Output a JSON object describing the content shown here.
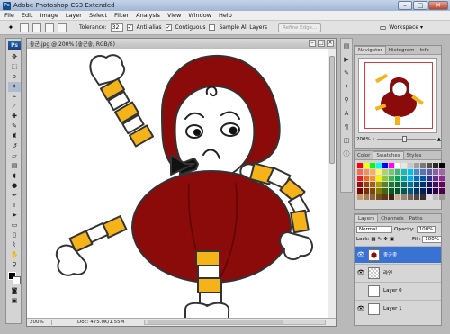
{
  "app": {
    "title": "Adobe Photoshop CS3 Extended",
    "logo_text": "Ps"
  },
  "window_controls": {
    "minimize": "–",
    "maximize": "□",
    "close": "✕"
  },
  "menu": [
    "File",
    "Edit",
    "Image",
    "Layer",
    "Select",
    "Filter",
    "Analysis",
    "View",
    "Window",
    "Help"
  ],
  "options_bar": {
    "tolerance_label": "Tolerance:",
    "tolerance_value": "32",
    "anti_alias_label": "Anti-alias",
    "contiguous_label": "Contiguous",
    "sample_all_label": "Sample All Layers",
    "refine_edge_label": "Refine Edge...",
    "workspace_label": "Workspace ▾"
  },
  "document": {
    "title": "좋군.jpg @ 200% (좋군좋, RGB/8)",
    "zoom": "200%",
    "doc_size": "Doc: 475.0K/1.55M"
  },
  "navigator": {
    "tabs": [
      "Navigator",
      "Histogram",
      "Info"
    ],
    "zoom": "200%"
  },
  "swatches": {
    "tabs": [
      "Color",
      "Swatches",
      "Styles"
    ],
    "colors": [
      "#ff0000",
      "#ffff00",
      "#00ff00",
      "#00ffff",
      "#0000ff",
      "#ff00ff",
      "#ffffff",
      "#e6e6e6",
      "#c8c8c8",
      "#a0a0a0",
      "#787878",
      "#505050",
      "#282828",
      "#000000",
      "#f26c4f",
      "#f68e55",
      "#fbaf5c",
      "#fff467",
      "#acd372",
      "#7cc576",
      "#3bb878",
      "#1abbb4",
      "#00bff3",
      "#438ccb",
      "#5574b9",
      "#605ca8",
      "#855fa8",
      "#a763a8",
      "#ed1c24",
      "#f26522",
      "#f7941d",
      "#fff200",
      "#8dc63f",
      "#39b54a",
      "#00a651",
      "#00a99d",
      "#00aeef",
      "#0072bc",
      "#0054a6",
      "#2e3192",
      "#662d91",
      "#92278f",
      "#9e0b0f",
      "#a0410d",
      "#a36209",
      "#aba000",
      "#598527",
      "#1a7b30",
      "#007236",
      "#00746b",
      "#0076a3",
      "#004a80",
      "#003471",
      "#1b1464",
      "#440e62",
      "#630460",
      "#790000",
      "#7b2e00",
      "#7d4900",
      "#827b00",
      "#406618",
      "#005e20",
      "#005826",
      "#005952",
      "#005b7f",
      "#003663",
      "#002157",
      "#0d004c",
      "#32004b",
      "#4b0049",
      "#c69c6d",
      "#a67c52",
      "#8c6239",
      "#754c24",
      "#603913",
      "#3c2415",
      "#c7b299",
      "#998675",
      "#736357",
      "#534741",
      "#362f2d",
      "#dddddd",
      "#bbbbbb",
      "#999999"
    ]
  },
  "layers": {
    "tabs": [
      "Layers",
      "Channels",
      "Paths"
    ],
    "blend_mode": "Normal",
    "opacity_label": "Opacity:",
    "opacity_value": "100%",
    "lock_label": "Lock:",
    "fill_label": "Fill:",
    "fill_value": "100%",
    "items": [
      {
        "name": "좋군좋",
        "active": true,
        "visible": true
      },
      {
        "name": "라인",
        "active": false,
        "visible": true
      },
      {
        "name": "Layer 0",
        "active": false,
        "visible": false
      },
      {
        "name": "Layer 1",
        "active": false,
        "visible": true
      }
    ]
  },
  "colors": {
    "accent_selection": "#3a72d4",
    "drawing_red": "#8b0a0a",
    "drawing_yellow": "#f5b31a"
  }
}
